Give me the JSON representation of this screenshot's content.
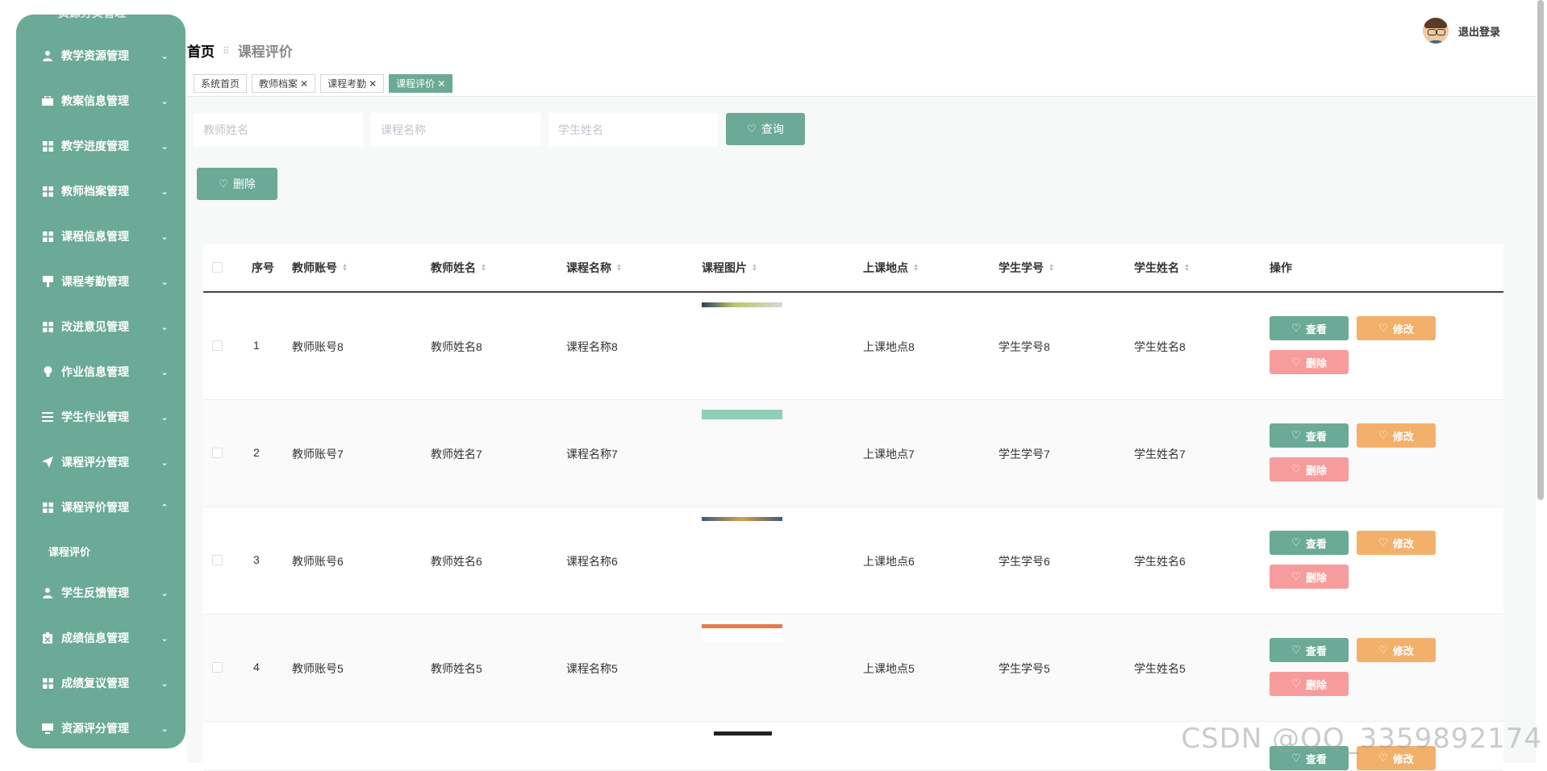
{
  "sidebar": {
    "top_partial": "资源分类管理",
    "items": [
      {
        "label": "教学资源管理",
        "icon": "user-icon",
        "arrow": "⌄"
      },
      {
        "label": "教案信息管理",
        "icon": "briefcase-icon",
        "arrow": "⌄"
      },
      {
        "label": "教学进度管理",
        "icon": "grid-icon",
        "arrow": "⌄"
      },
      {
        "label": "教师档案管理",
        "icon": "grid-icon",
        "arrow": "⌄"
      },
      {
        "label": "课程信息管理",
        "icon": "grid-icon",
        "arrow": "⌄"
      },
      {
        "label": "课程考勤管理",
        "icon": "sign-icon",
        "arrow": "⌄"
      },
      {
        "label": "改进意见管理",
        "icon": "grid-icon",
        "arrow": "⌄"
      },
      {
        "label": "作业信息管理",
        "icon": "bulb-icon",
        "arrow": "⌄"
      },
      {
        "label": "学生作业管理",
        "icon": "list-icon",
        "arrow": "⌄"
      },
      {
        "label": "课程评分管理",
        "icon": "send-icon",
        "arrow": "⌄"
      },
      {
        "label": "课程评价管理",
        "icon": "grid-icon",
        "arrow": "⌃"
      },
      {
        "label": "学生反馈管理",
        "icon": "user-icon",
        "arrow": "⌄"
      },
      {
        "label": "成绩信息管理",
        "icon": "clipboard-icon",
        "arrow": "⌄"
      },
      {
        "label": "成绩复议管理",
        "icon": "grid-icon",
        "arrow": "⌄"
      },
      {
        "label": "资源评分管理",
        "icon": "monitor-icon",
        "arrow": "⌄"
      }
    ],
    "sub_item": "课程评价"
  },
  "header": {
    "home": "首页",
    "current": "课程评价",
    "logout": "退出登录"
  },
  "tabs": [
    {
      "label": "系统首页",
      "closable": false
    },
    {
      "label": "教师档案",
      "closable": true
    },
    {
      "label": "课程考勤",
      "closable": true
    },
    {
      "label": "课程评价",
      "closable": true,
      "active": true
    }
  ],
  "search": {
    "teacher_name_placeholder": "教师姓名",
    "course_name_placeholder": "课程名称",
    "student_name_placeholder": "学生姓名",
    "query_label": "查询"
  },
  "toolbar": {
    "delete_label": "删除"
  },
  "table": {
    "columns": [
      "序号",
      "教师账号",
      "教师姓名",
      "课程名称",
      "课程图片",
      "上课地点",
      "学生学号",
      "学生姓名",
      "操作"
    ],
    "rows": [
      {
        "index": "1",
        "teacher_account": "教师账号8",
        "teacher_name": "教师姓名8",
        "course_name": "课程名称8",
        "location": "上课地点8",
        "student_id": "学生学号8",
        "student_name": "学生姓名8"
      },
      {
        "index": "2",
        "teacher_account": "教师账号7",
        "teacher_name": "教师姓名7",
        "course_name": "课程名称7",
        "location": "上课地点7",
        "student_id": "学生学号7",
        "student_name": "学生姓名7"
      },
      {
        "index": "3",
        "teacher_account": "教师账号6",
        "teacher_name": "教师姓名6",
        "course_name": "课程名称6",
        "location": "上课地点6",
        "student_id": "学生学号6",
        "student_name": "学生姓名6"
      },
      {
        "index": "4",
        "teacher_account": "教师账号5",
        "teacher_name": "教师姓名5",
        "course_name": "课程名称5",
        "location": "上课地点5",
        "student_id": "学生学号5",
        "student_name": "学生姓名5"
      }
    ],
    "actions": {
      "view": "查看",
      "edit": "修改",
      "delete": "删除"
    }
  },
  "watermark": "CSDN @QQ_3359892174",
  "colors": {
    "accent": "#6aaa96",
    "edit": "#f3b06a",
    "delete": "#f79c9c"
  }
}
